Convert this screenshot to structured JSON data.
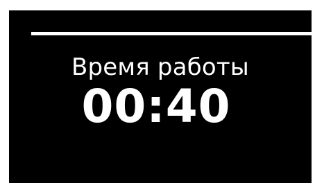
{
  "display": {
    "label": "Время работы",
    "value": "00:40",
    "background_color": "#000000",
    "text_color": "#ffffff"
  }
}
